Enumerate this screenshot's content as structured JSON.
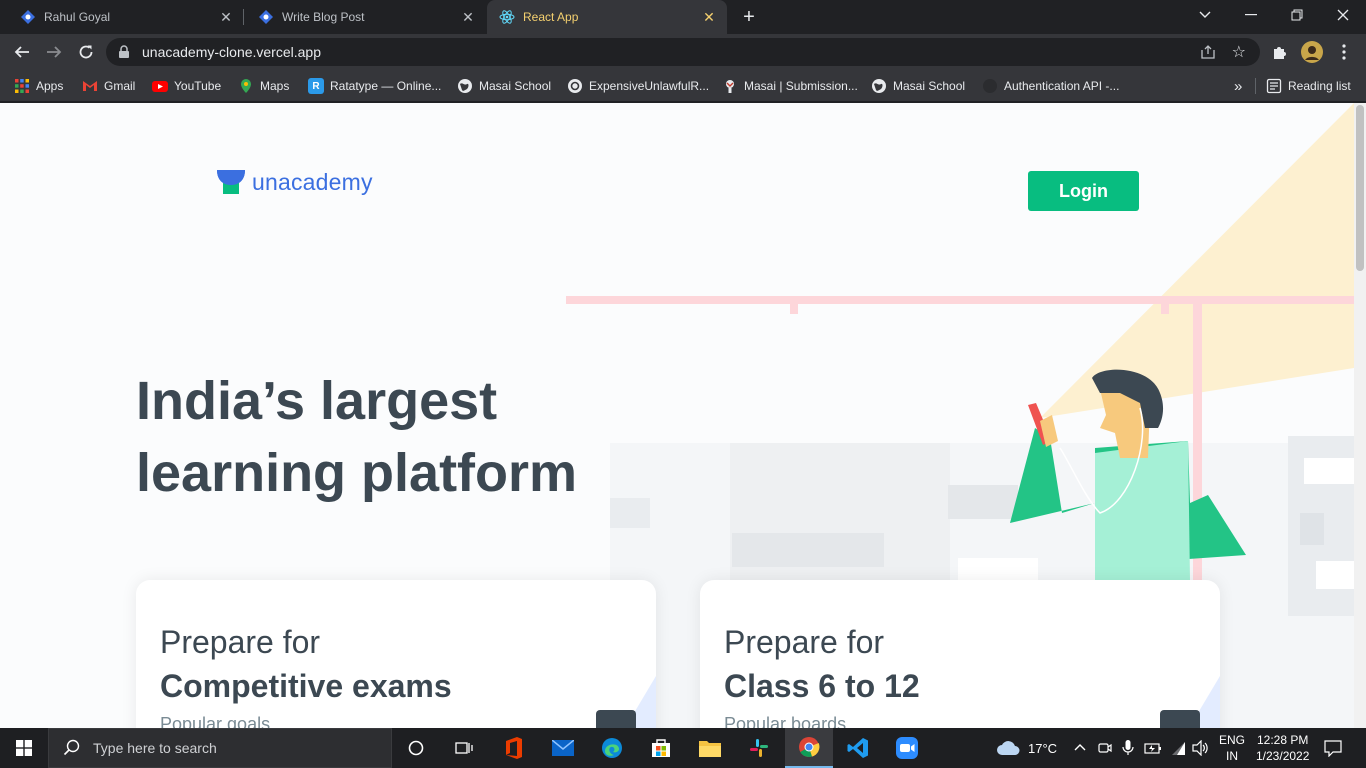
{
  "tabs": [
    {
      "title": "Rahul Goyal",
      "close": "✕"
    },
    {
      "title": "Write Blog Post",
      "close": "✕"
    },
    {
      "title": "React App",
      "close": "✕"
    }
  ],
  "toolbar": {
    "url": "unacademy-clone.vercel.app"
  },
  "bookmarks": {
    "items": [
      "Apps",
      "Gmail",
      "YouTube",
      "Maps",
      "Ratatype — Online...",
      "Masai School",
      "ExpensiveUnlawfulR...",
      "Masai | Submission...",
      "Masai School",
      "Authentication API -..."
    ],
    "overflow": "»",
    "reading_list": "Reading list"
  },
  "page": {
    "logo_text": "unacademy",
    "login_label": "Login",
    "headline_line1": "India’s largest",
    "headline_line2": "learning platform",
    "cards": [
      {
        "line1": "Prepare for",
        "line2": "Competitive exams",
        "line3": "Popular goals"
      },
      {
        "line1": "Prepare for",
        "line2": "Class 6 to 12",
        "line3": "Popular boards"
      }
    ]
  },
  "taskbar": {
    "search_placeholder": "Type here to search",
    "weather": "17°C",
    "lang1": "ENG",
    "lang2": "IN",
    "time": "12:28 PM",
    "date": "1/23/2022"
  },
  "colors": {
    "brand_green": "#08bd80",
    "brand_blue": "#3b6fe0",
    "headline": "#3c4852"
  }
}
